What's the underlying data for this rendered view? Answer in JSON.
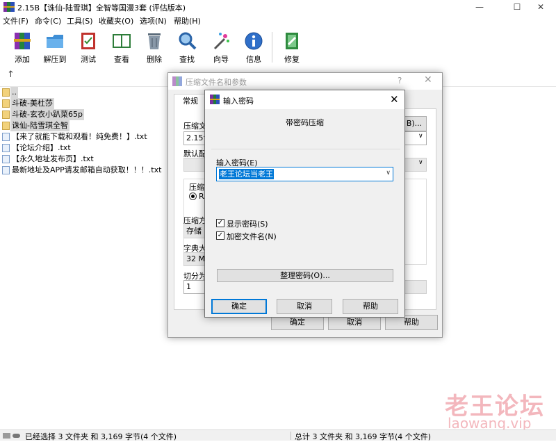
{
  "window": {
    "title": "2.15B【诛仙-陆雪琪】全智等国漫3套 (评估版本)",
    "controls": [
      "—",
      "☐",
      "✕"
    ]
  },
  "menu": [
    "文件(F)",
    "命令(C)",
    "工具(S)",
    "收藏夹(O)",
    "选项(N)",
    "帮助(H)"
  ],
  "toolbar": [
    {
      "label": "添加",
      "icon": "add-archive-icon"
    },
    {
      "label": "解压到",
      "icon": "extract-to-icon"
    },
    {
      "label": "测试",
      "icon": "test-icon"
    },
    {
      "label": "查看",
      "icon": "view-icon"
    },
    {
      "label": "删除",
      "icon": "delete-icon"
    },
    {
      "label": "查找",
      "icon": "find-icon"
    },
    {
      "label": "向导",
      "icon": "wizard-icon"
    },
    {
      "label": "信息",
      "icon": "info-icon"
    },
    {
      "label": "修复",
      "icon": "repair-icon"
    }
  ],
  "files": [
    {
      "name": "..",
      "type": "folder"
    },
    {
      "name": "斗破-美杜莎",
      "type": "folder"
    },
    {
      "name": "斗破-玄衣小趴菜65p",
      "type": "folder"
    },
    {
      "name": "诛仙-陆雪琪全智",
      "type": "folder"
    },
    {
      "name": "【来了就能下载和观看！纯免费！】.txt",
      "type": "txt"
    },
    {
      "name": "【论坛介绍】.txt",
      "type": "txt"
    },
    {
      "name": "【永久地址发布页】.txt",
      "type": "txt"
    },
    {
      "name": "最新地址及APP请发邮箱自动获取！！！.txt",
      "type": "txt"
    }
  ],
  "status": {
    "left": "已经选择 3 文件夹 和 3,169 字节(4 个文件)",
    "right": "总计 3 文件夹 和 3,169 字节(4 个文件)"
  },
  "watermark": {
    "cn": "老王论坛",
    "url": "laowang.vip"
  },
  "archive_dialog": {
    "title": "压缩文件名和参数",
    "help": "?",
    "close": "✕",
    "tab": "常规",
    "archive_name_label": "压缩文",
    "archive_name_value": "2.15诛",
    "browse": "B)...",
    "default_label": "默认配",
    "format_label": "压缩",
    "format_value": "RA",
    "method_label": "压缩方",
    "method_value": "存储",
    "dict_label": "字典大",
    "dict_value": "32 MB",
    "split_label": "切分为",
    "split_value": "1",
    "ok": "确定",
    "cancel": "取消",
    "help_btn": "帮助"
  },
  "password_dialog": {
    "title": "输入密码",
    "close": "✕",
    "header": "带密码压缩",
    "enter_label": "输入密码(E)",
    "password_value": "老王论坛当老王",
    "show_password": "显示密码(S)",
    "encrypt_names": "加密文件名(N)",
    "organize": "整理密码(O)...",
    "ok": "确定",
    "cancel": "取消",
    "help": "帮助"
  },
  "colors": {
    "accent": "#0078d7",
    "watermark": "#f3b7bd",
    "folder": "#f2d27c"
  }
}
